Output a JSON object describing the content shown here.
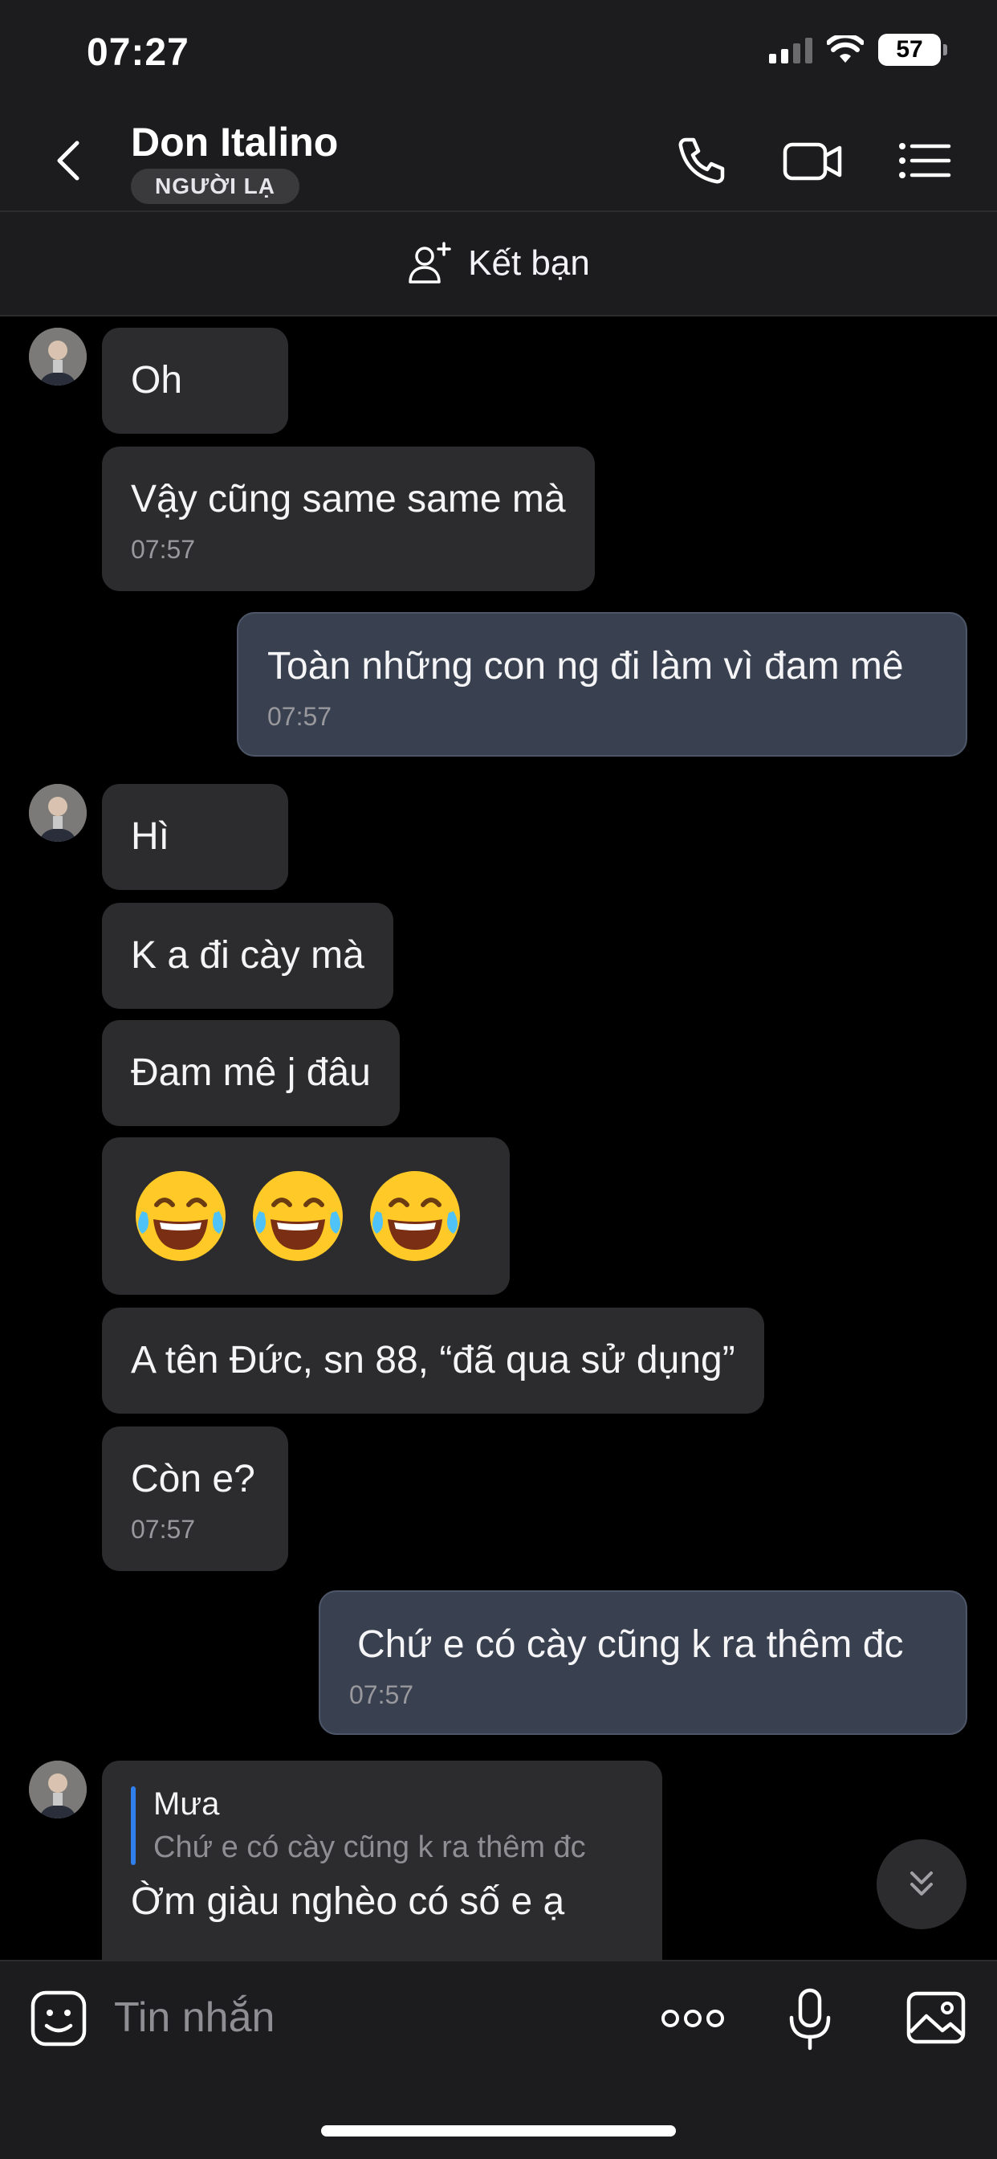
{
  "status_bar": {
    "time": "07:27",
    "battery": "57",
    "icons": [
      "cellular-signal-icon",
      "wifi-icon",
      "battery-icon"
    ]
  },
  "header": {
    "contact_name": "Don Italino",
    "badge": "NGƯỜI LẠ",
    "icons": [
      "back-chevron-icon",
      "phone-icon",
      "video-call-icon",
      "menu-list-icon"
    ]
  },
  "add_friend": {
    "label": "Kết bạn",
    "icon": "add-person-icon"
  },
  "messages": [
    {
      "side": "in",
      "text": "Oh"
    },
    {
      "side": "in",
      "text": "Vậy cũng same same mà",
      "time": "07:57"
    },
    {
      "side": "out",
      "text": "Toàn những con ng đi làm vì đam mê",
      "time": "07:57"
    },
    {
      "side": "in",
      "text": "Hì"
    },
    {
      "side": "in",
      "text": "K a đi cày mà"
    },
    {
      "side": "in",
      "text": "Đam mê j đâu"
    },
    {
      "side": "in",
      "emoji": [
        "😂",
        "😂",
        "😂"
      ]
    },
    {
      "side": "in",
      "text": "A tên Đức, sn 88, “đã qua sử dụng”"
    },
    {
      "side": "in",
      "text": "Còn e?",
      "time": "07:57"
    },
    {
      "side": "out",
      "text": "Chứ e có cày cũng k ra thêm đc",
      "time": "07:57"
    },
    {
      "side": "in",
      "quote_author": "Mưa",
      "quote_text": "Chứ e có cày cũng k ra thêm đc",
      "text": "Ờm giàu nghèo có số e ạ"
    }
  ],
  "input": {
    "placeholder": "Tin nhắn",
    "icons": [
      "sticker-icon",
      "more-icon",
      "microphone-icon",
      "image-icon"
    ]
  },
  "colors": {
    "bubble_in": "#2c2c2e",
    "bubble_out": "#394150",
    "accent": "#2f80ed",
    "background": "#000000"
  }
}
